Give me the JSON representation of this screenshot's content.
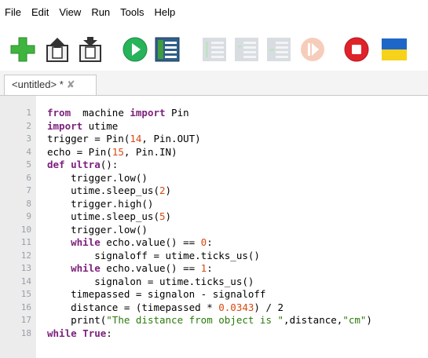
{
  "menu": [
    "File",
    "Edit",
    "View",
    "Run",
    "Tools",
    "Help"
  ],
  "toolbar": {
    "buttons": [
      "new-file",
      "open-file",
      "save-file",
      "run",
      "debug",
      "step-over",
      "step-into",
      "step-out",
      "resume",
      "stop",
      "flag"
    ]
  },
  "tab": {
    "title": "<untitled> *",
    "close_glyph": "✘"
  },
  "editor": {
    "lines": [
      {
        "n": "1",
        "t": [
          [
            "kw",
            "from"
          ],
          [
            "",
            "  machine "
          ],
          [
            "kw",
            "import"
          ],
          [
            "",
            " Pin"
          ]
        ]
      },
      {
        "n": "2",
        "t": [
          [
            "kw",
            "import"
          ],
          [
            "",
            " utime"
          ]
        ]
      },
      {
        "n": "3",
        "t": [
          [
            "",
            "trigger = Pin("
          ],
          [
            "num",
            "14"
          ],
          [
            "",
            ", Pin.OUT)"
          ]
        ]
      },
      {
        "n": "4",
        "t": [
          [
            "",
            "echo = Pin("
          ],
          [
            "num",
            "15"
          ],
          [
            "",
            ", Pin.IN)"
          ]
        ]
      },
      {
        "n": "5",
        "t": [
          [
            "kw",
            "def"
          ],
          [
            "",
            " "
          ],
          [
            "kw",
            "ultra"
          ],
          [
            "",
            "():"
          ]
        ]
      },
      {
        "n": "6",
        "t": [
          [
            "",
            "    trigger.low()"
          ]
        ]
      },
      {
        "n": "7",
        "t": [
          [
            "",
            "    utime.sleep_us("
          ],
          [
            "num",
            "2"
          ],
          [
            "",
            ")"
          ]
        ]
      },
      {
        "n": "8",
        "t": [
          [
            "",
            "    trigger.high()"
          ]
        ]
      },
      {
        "n": "9",
        "t": [
          [
            "",
            "    utime.sleep_us("
          ],
          [
            "num",
            "5"
          ],
          [
            "",
            ")"
          ]
        ]
      },
      {
        "n": "10",
        "t": [
          [
            "",
            "    trigger.low()"
          ]
        ]
      },
      {
        "n": "11",
        "t": [
          [
            "kw",
            "    while"
          ],
          [
            "",
            " echo.value() == "
          ],
          [
            "num",
            "0"
          ],
          [
            "",
            ":"
          ]
        ]
      },
      {
        "n": "12",
        "t": [
          [
            "",
            "        signaloff = utime.ticks_us()"
          ]
        ]
      },
      {
        "n": "13",
        "t": [
          [
            "kw",
            "    while"
          ],
          [
            "",
            " echo.value() == "
          ],
          [
            "num",
            "1"
          ],
          [
            "",
            ":"
          ]
        ]
      },
      {
        "n": "14",
        "t": [
          [
            "",
            "        signalon = utime.ticks_us()"
          ]
        ]
      },
      {
        "n": "15",
        "t": [
          [
            "",
            "    timepassed = signalon - signaloff"
          ]
        ]
      },
      {
        "n": "16",
        "t": [
          [
            "",
            "    distance = (timepassed * "
          ],
          [
            "num",
            "0.0343"
          ],
          [
            "",
            ") / 2"
          ]
        ]
      },
      {
        "n": "17",
        "t": [
          [
            "",
            "    print("
          ],
          [
            "str",
            "\"The distance from object is \""
          ],
          [
            "",
            ",distance,"
          ],
          [
            "str",
            "\"cm\""
          ],
          [
            "",
            ")"
          ]
        ]
      },
      {
        "n": "18",
        "t": [
          [
            "kw",
            "while"
          ],
          [
            "",
            " "
          ],
          [
            "kw",
            "True"
          ],
          [
            "",
            ":"
          ]
        ]
      }
    ]
  }
}
